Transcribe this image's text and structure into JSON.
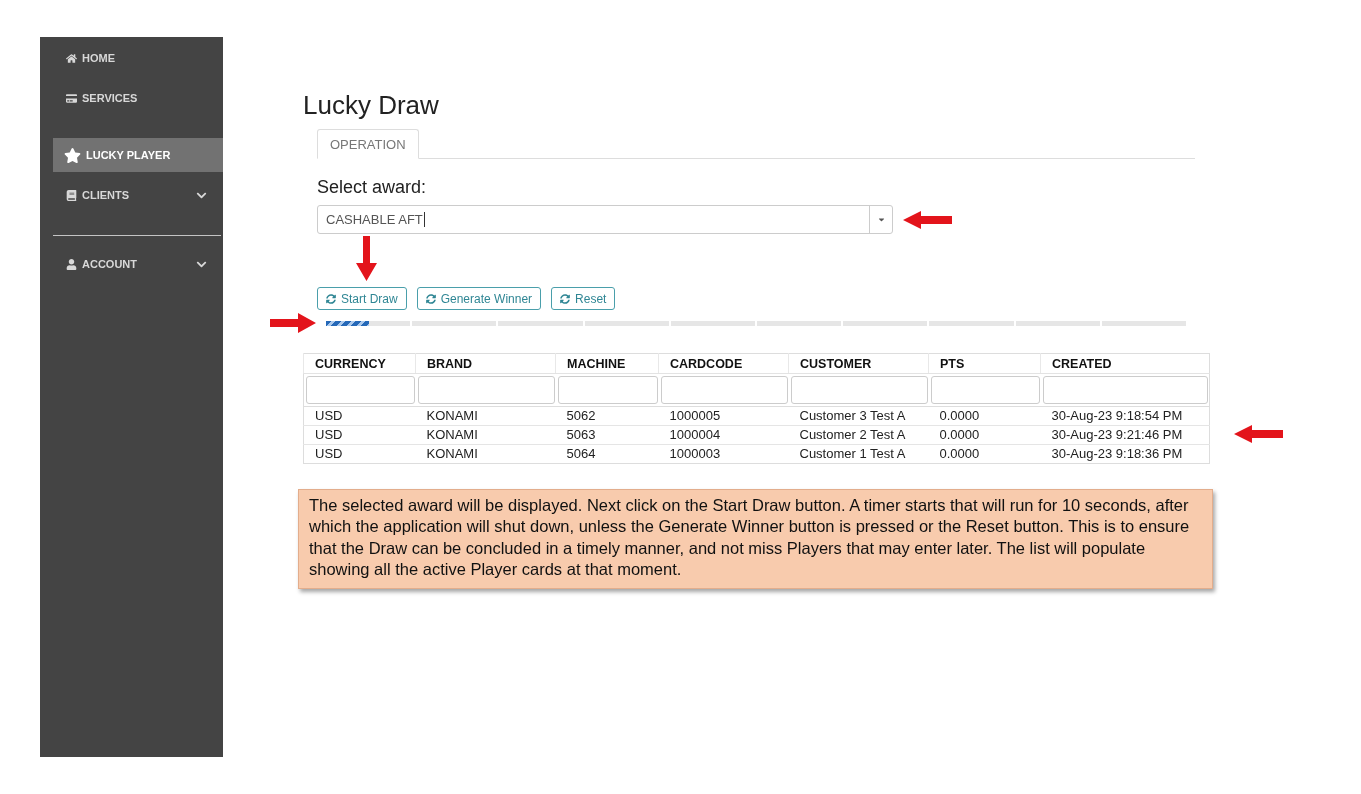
{
  "sidebar": {
    "sections": [
      {
        "divider_above": false,
        "items": [
          {
            "label": "HOME",
            "kind": "link",
            "selected": false
          },
          {
            "label": "SERVICES",
            "kind": "link",
            "selected": false
          }
        ]
      },
      {
        "divider_above": false,
        "items": [
          {
            "label": "LUCKY PLAYER",
            "kind": "link",
            "selected": true
          },
          {
            "label": "CLIENTS",
            "kind": "menu",
            "selected": false
          }
        ]
      },
      {
        "divider_above": true,
        "items": [
          {
            "label": "ACCOUNT",
            "kind": "menu",
            "selected": false
          }
        ]
      }
    ]
  },
  "page": {
    "title": "Lucky Draw"
  },
  "tabs": [
    {
      "label": "OPERATION",
      "selected": true
    }
  ],
  "award": {
    "label": "Select award:",
    "value": "CASHABLE AFT"
  },
  "buttons": [
    {
      "label": "Start Draw"
    },
    {
      "label": "Generate Winner"
    },
    {
      "label": "Reset"
    }
  ],
  "progress": {
    "level": 0.05
  },
  "table": {
    "columns": [
      "CURRENCY",
      "BRAND",
      "MACHINE",
      "CARDCODE",
      "CUSTOMER",
      "PTS",
      "CREATED"
    ],
    "rows": [
      [
        "USD",
        "KONAMI",
        "5062",
        "1000005",
        "Customer 3 Test A",
        "0.0000",
        "30-Aug-23 9:18:54 PM"
      ],
      [
        "USD",
        "KONAMI",
        "5063",
        "1000004",
        "Customer 2 Test A",
        "0.0000",
        "30-Aug-23 9:21:46 PM"
      ],
      [
        "USD",
        "KONAMI",
        "5064",
        "1000003",
        "Customer 1 Test A",
        "0.0000",
        "30-Aug-23 9:18:36 PM"
      ]
    ]
  },
  "note": {
    "text": "The selected award will be displayed. Next click on the Start Draw button. A timer starts that will run for 10 seconds, after which the application will shut down, unless the Generate Winner button is pressed or the Reset button. This is to ensure that the Draw can be concluded in a timely manner, and not miss Players that may enter later. The list will populate showing all the active Player cards at that moment."
  }
}
